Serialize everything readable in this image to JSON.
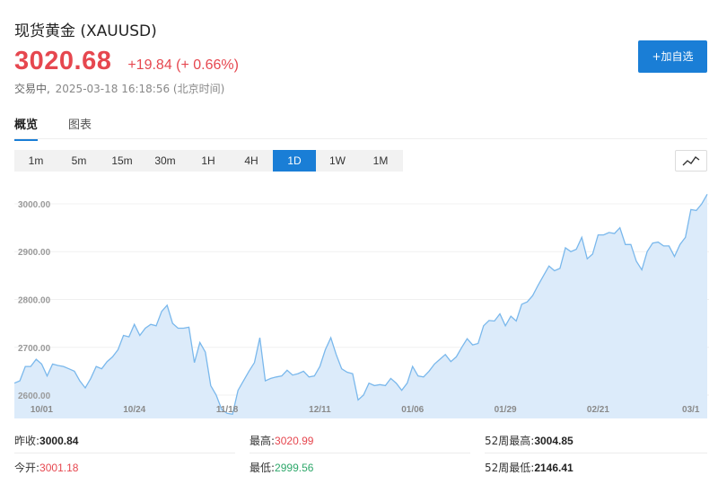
{
  "header": {
    "title": "现货黄金 (XAUUSD)",
    "price": "3020.68",
    "change": "+19.84 (+ 0.66%)",
    "status": "交易中,",
    "timestamp": "2025-03-18 16:18:56 (北京时间)",
    "add_button": "+加自选"
  },
  "tabs": [
    {
      "label": "概览",
      "active": true
    },
    {
      "label": "图表",
      "active": false
    }
  ],
  "periods": [
    {
      "label": "1m",
      "active": false
    },
    {
      "label": "5m",
      "active": false
    },
    {
      "label": "15m",
      "active": false
    },
    {
      "label": "30m",
      "active": false
    },
    {
      "label": "1H",
      "active": false
    },
    {
      "label": "4H",
      "active": false
    },
    {
      "label": "1D",
      "active": true
    },
    {
      "label": "1W",
      "active": false
    },
    {
      "label": "1M",
      "active": false
    }
  ],
  "chart_icon": "line-chart-icon",
  "colors": {
    "accent": "#1a7ed6",
    "up": "#e6474f",
    "down": "#2fa86b",
    "line": "#7ab8ec",
    "fill": "#dcebfa"
  },
  "chart_data": {
    "type": "area",
    "ylim": [
      2555,
      3030
    ],
    "yticks": [
      2600,
      2700,
      2800,
      2900,
      3000
    ],
    "ytick_labels": [
      "2600.00",
      "2700.00",
      "2800.00",
      "2900.00",
      "3000.00"
    ],
    "xticks": [
      {
        "index": 5,
        "label": "10/01"
      },
      {
        "index": 22,
        "label": "10/24"
      },
      {
        "index": 39,
        "label": "11/18"
      },
      {
        "index": 56,
        "label": "12/11"
      },
      {
        "index": 73,
        "label": "01/06"
      },
      {
        "index": 90,
        "label": "01/29"
      },
      {
        "index": 107,
        "label": "02/21"
      },
      {
        "index": 124,
        "label": "03/1"
      }
    ],
    "values": [
      2625,
      2630,
      2660,
      2660,
      2675,
      2665,
      2640,
      2665,
      2662,
      2660,
      2655,
      2650,
      2630,
      2615,
      2635,
      2660,
      2655,
      2670,
      2680,
      2695,
      2725,
      2722,
      2748,
      2725,
      2740,
      2748,
      2745,
      2775,
      2788,
      2750,
      2740,
      2740,
      2742,
      2668,
      2710,
      2690,
      2620,
      2600,
      2570,
      2562,
      2560,
      2610,
      2630,
      2650,
      2668,
      2720,
      2630,
      2635,
      2638,
      2640,
      2652,
      2642,
      2645,
      2650,
      2638,
      2640,
      2660,
      2695,
      2720,
      2685,
      2655,
      2648,
      2645,
      2590,
      2600,
      2625,
      2620,
      2622,
      2620,
      2635,
      2625,
      2610,
      2625,
      2660,
      2640,
      2638,
      2650,
      2665,
      2675,
      2685,
      2670,
      2680,
      2700,
      2718,
      2705,
      2708,
      2745,
      2756,
      2755,
      2770,
      2745,
      2765,
      2755,
      2790,
      2795,
      2808,
      2830,
      2850,
      2870,
      2860,
      2865,
      2908,
      2900,
      2905,
      2930,
      2885,
      2895,
      2935,
      2935,
      2940,
      2938,
      2950,
      2915,
      2915,
      2880,
      2862,
      2900,
      2918,
      2920,
      2912,
      2912,
      2890,
      2915,
      2930,
      2988,
      2986,
      3000,
      3020
    ]
  },
  "stats": [
    [
      {
        "label": "昨收:",
        "value": "3000.84",
        "style": "bold"
      },
      {
        "label": "最高:",
        "value": "3020.99",
        "style": "red"
      },
      {
        "label": "52周最高:",
        "value": "3004.85",
        "style": "bold"
      }
    ],
    [
      {
        "label": "今开:",
        "value": "3001.18",
        "style": "red"
      },
      {
        "label": "最低:",
        "value": "2999.56",
        "style": "green"
      },
      {
        "label": "52周最低:",
        "value": "2146.41",
        "style": "bold"
      }
    ]
  ]
}
